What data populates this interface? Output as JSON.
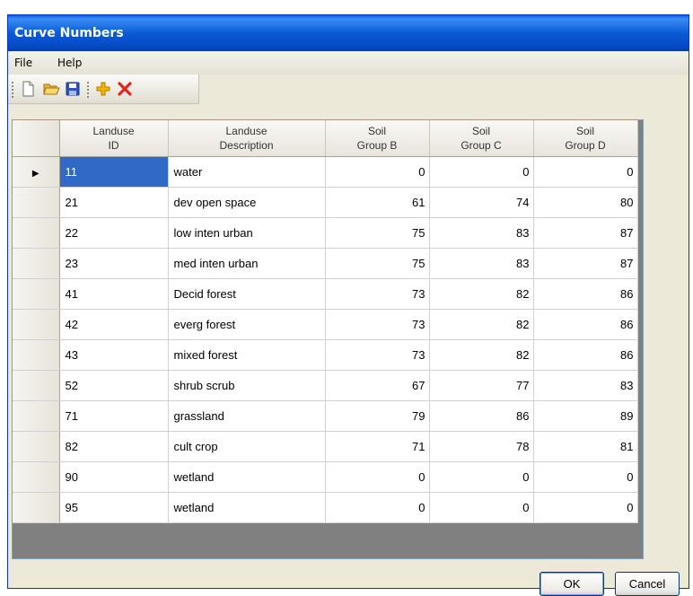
{
  "window": {
    "title": "Curve Numbers"
  },
  "menu": {
    "items": [
      "File",
      "Help"
    ]
  },
  "toolbar": {
    "buttons": [
      "new-icon",
      "open-folder-icon",
      "save-icon",
      "add-row-icon",
      "delete-row-icon"
    ]
  },
  "table": {
    "headers": {
      "id": [
        "Landuse",
        "ID"
      ],
      "desc": [
        "Landuse",
        "Description"
      ],
      "b": [
        "Soil",
        "Group B"
      ],
      "c": [
        "Soil",
        "Group C"
      ],
      "d": [
        "Soil",
        "Group D"
      ]
    },
    "rows": [
      {
        "id": "11",
        "desc": "water",
        "b": "0",
        "c": "0",
        "d": "0"
      },
      {
        "id": "21",
        "desc": "dev open space",
        "b": "61",
        "c": "74",
        "d": "80"
      },
      {
        "id": "22",
        "desc": "low inten urban",
        "b": "75",
        "c": "83",
        "d": "87"
      },
      {
        "id": "23",
        "desc": "med inten urban",
        "b": "75",
        "c": "83",
        "d": "87"
      },
      {
        "id": "41",
        "desc": "Decid forest",
        "b": "73",
        "c": "82",
        "d": "86"
      },
      {
        "id": "42",
        "desc": "everg forest",
        "b": "73",
        "c": "82",
        "d": "86"
      },
      {
        "id": "43",
        "desc": "mixed forest",
        "b": "73",
        "c": "82",
        "d": "86"
      },
      {
        "id": "52",
        "desc": "shrub scrub",
        "b": "67",
        "c": "77",
        "d": "83"
      },
      {
        "id": "71",
        "desc": "grassland",
        "b": "79",
        "c": "86",
        "d": "89"
      },
      {
        "id": "82",
        "desc": "cult crop",
        "b": "71",
        "c": "78",
        "d": "81"
      },
      {
        "id": "90",
        "desc": "wetland",
        "b": "0",
        "c": "0",
        "d": "0"
      },
      {
        "id": "95",
        "desc": "wetland",
        "b": "0",
        "c": "0",
        "d": "0"
      }
    ],
    "selected_row_index": 0,
    "row_indicator": "▶"
  },
  "buttons": {
    "ok": "OK",
    "cancel": "Cancel"
  }
}
